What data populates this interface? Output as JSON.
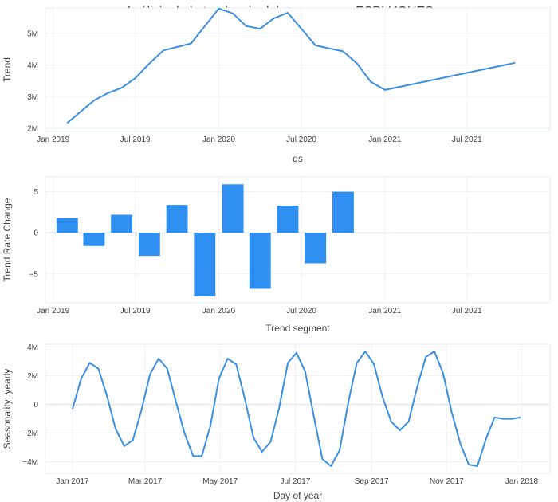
{
  "title": "Análisis de la tendencia del consumo en ESPLUGUES",
  "colors": {
    "line": "#3a8ee6",
    "bar": "#2f8ff0",
    "grid": "#eef1f7",
    "frame": "#e6ecf5",
    "text": "#444444"
  },
  "chart_data": [
    {
      "type": "line",
      "xlabel": "ds",
      "ylabel": "Trend",
      "x_ticks": [
        "Jan 2019",
        "Jul 2019",
        "Jan 2020",
        "Jul 2020",
        "Jan 2021",
        "Jul 2021"
      ],
      "x_tick_dates": [
        "2019-01-01",
        "2019-07-01",
        "2020-01-01",
        "2020-07-01",
        "2021-01-01",
        "2021-07-01"
      ],
      "x_range": [
        "2018-12-15",
        "2021-12-31"
      ],
      "y_ticks": [
        2,
        3,
        4,
        5
      ],
      "y_tick_labels": [
        "2M",
        "3M",
        "4M",
        "5M"
      ],
      "ylim": [
        1.9,
        5.8
      ],
      "x": [
        "2019-02-01",
        "2019-04-01",
        "2019-05-01",
        "2019-06-01",
        "2019-07-01",
        "2019-08-01",
        "2019-09-01",
        "2019-11-01",
        "2020-01-01",
        "2020-02-01",
        "2020-03-01",
        "2020-04-01",
        "2020-05-01",
        "2020-06-01",
        "2020-08-01",
        "2020-09-01",
        "2020-10-01",
        "2020-11-01",
        "2020-12-01",
        "2021-01-01",
        "2021-10-15"
      ],
      "values": [
        2.17,
        2.88,
        3.11,
        3.28,
        3.58,
        4.05,
        4.46,
        4.68,
        5.78,
        5.63,
        5.23,
        5.14,
        5.47,
        5.65,
        4.62,
        4.52,
        4.43,
        4.04,
        3.47,
        3.21,
        4.07
      ]
    },
    {
      "type": "bar",
      "xlabel": "Trend segment",
      "ylabel": "Trend Rate Change",
      "x_ticks": [
        "Jan 2019",
        "Jul 2019",
        "Jan 2020",
        "Jul 2020",
        "Jan 2021",
        "Jul 2021"
      ],
      "x_tick_dates": [
        "2019-01-01",
        "2019-07-01",
        "2020-01-01",
        "2020-07-01",
        "2021-01-01",
        "2021-07-01"
      ],
      "x_range": [
        "2018-12-15",
        "2021-12-31"
      ],
      "y_ticks": [
        -5,
        0,
        5
      ],
      "y_tick_labels": [
        "−5",
        "0",
        "5"
      ],
      "ylim": [
        -8.5,
        6.8
      ],
      "x": [
        "2019-02-01",
        "2019-04-01",
        "2019-06-01",
        "2019-08-01",
        "2019-10-01",
        "2019-12-01",
        "2020-02-01",
        "2020-04-01",
        "2020-06-01",
        "2020-08-01",
        "2020-10-01",
        "2020-12-01"
      ],
      "values": [
        1.8,
        -1.6,
        2.2,
        -2.8,
        3.4,
        -7.7,
        5.9,
        -6.8,
        3.3,
        -3.7,
        5.0,
        0.0
      ]
    },
    {
      "type": "line",
      "xlabel": "Day of year",
      "ylabel": "Seasonality: yearly",
      "x_ticks": [
        "Jan 2017",
        "Mar 2017",
        "May 2017",
        "Jul 2017",
        "Sep 2017",
        "Nov 2017",
        "Jan 2018"
      ],
      "x_tick_dates": [
        "2017-01-01",
        "2017-03-01",
        "2017-05-01",
        "2017-07-01",
        "2017-09-01",
        "2017-11-01",
        "2018-01-01"
      ],
      "x_range": [
        "2016-12-10",
        "2018-01-24"
      ],
      "y_ticks": [
        -4,
        -2,
        0,
        2,
        4
      ],
      "y_tick_labels": [
        "−4M",
        "−2M",
        "0",
        "2M",
        "4M"
      ],
      "ylim": [
        -4.8,
        4.2
      ],
      "x": [
        "2017-01-01",
        "2017-01-08",
        "2017-01-15",
        "2017-01-22",
        "2017-01-29",
        "2017-02-05",
        "2017-02-12",
        "2017-02-19",
        "2017-02-26",
        "2017-03-05",
        "2017-03-12",
        "2017-03-19",
        "2017-03-26",
        "2017-04-02",
        "2017-04-09",
        "2017-04-16",
        "2017-04-23",
        "2017-04-30",
        "2017-05-07",
        "2017-05-14",
        "2017-05-21",
        "2017-05-28",
        "2017-06-04",
        "2017-06-11",
        "2017-06-18",
        "2017-06-25",
        "2017-07-02",
        "2017-07-09",
        "2017-07-16",
        "2017-07-23",
        "2017-07-30",
        "2017-08-06",
        "2017-08-13",
        "2017-08-20",
        "2017-08-27",
        "2017-09-03",
        "2017-09-10",
        "2017-09-17",
        "2017-09-24",
        "2017-10-01",
        "2017-10-08",
        "2017-10-15",
        "2017-10-22",
        "2017-10-29",
        "2017-11-05",
        "2017-11-12",
        "2017-11-19",
        "2017-11-26",
        "2017-12-03",
        "2017-12-10",
        "2017-12-17",
        "2017-12-24",
        "2017-12-31"
      ],
      "values": [
        -0.3,
        1.8,
        2.9,
        2.5,
        0.6,
        -1.7,
        -2.9,
        -2.5,
        -0.4,
        2.1,
        3.2,
        2.5,
        0.2,
        -2.0,
        -3.6,
        -3.6,
        -1.5,
        1.8,
        3.2,
        2.8,
        0.4,
        -2.3,
        -3.3,
        -2.6,
        -0.2,
        2.9,
        3.6,
        2.3,
        -0.8,
        -3.8,
        -4.3,
        -3.2,
        0.1,
        2.9,
        3.7,
        2.8,
        0.5,
        -1.2,
        -1.8,
        -1.2,
        1.2,
        3.3,
        3.7,
        2.2,
        -0.5,
        -2.7,
        -4.2,
        -4.3,
        -2.4,
        -0.9,
        -1.0,
        -1.0,
        -0.9
      ]
    }
  ]
}
